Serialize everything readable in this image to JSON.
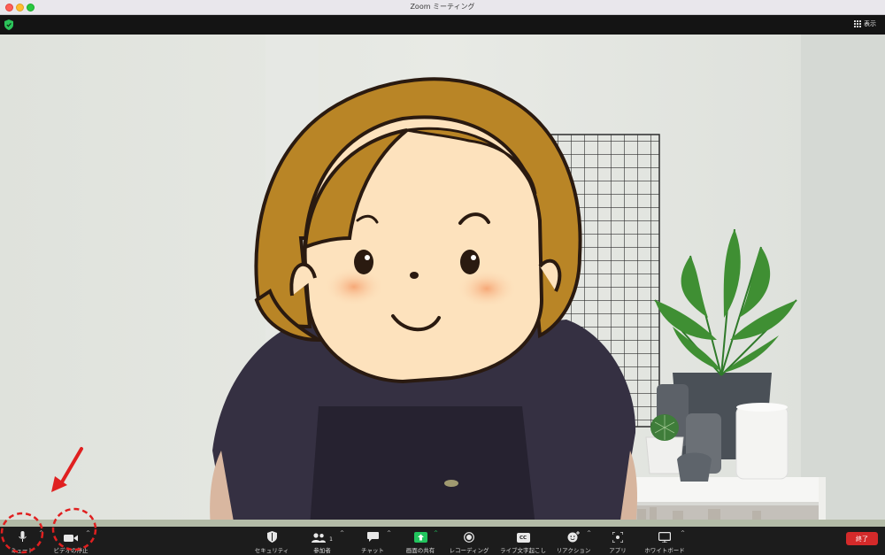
{
  "window": {
    "title": "Zoom ミーティング"
  },
  "topbar": {
    "view_label": "表示"
  },
  "toolbar": {
    "mute": "ミュート",
    "video_stop": "ビデオの停止",
    "security": "セキュリティ",
    "participants": "参加者",
    "participants_count": "1",
    "chat": "チャット",
    "share_screen": "画面の共有",
    "recording": "レコーディング",
    "live_transcript": "ライブ文字起こし",
    "cc_badge": "CC",
    "reactions": "リアクション",
    "apps": "アプリ",
    "whiteboard": "ホワイトボード",
    "end": "終了"
  },
  "colors": {
    "toolbar_bg": "#1c1c1c",
    "share_accent": "#22c55e",
    "end_button": "#d42a2a",
    "annotation_red": "#e02020"
  },
  "icons": [
    "shield-icon",
    "grid-icon",
    "microphone-icon",
    "video-camera-icon",
    "security-shield-icon",
    "participants-icon",
    "chat-bubble-icon",
    "share-screen-icon",
    "record-icon",
    "cc-icon",
    "reaction-emoji-icon",
    "apps-icon",
    "whiteboard-icon"
  ]
}
